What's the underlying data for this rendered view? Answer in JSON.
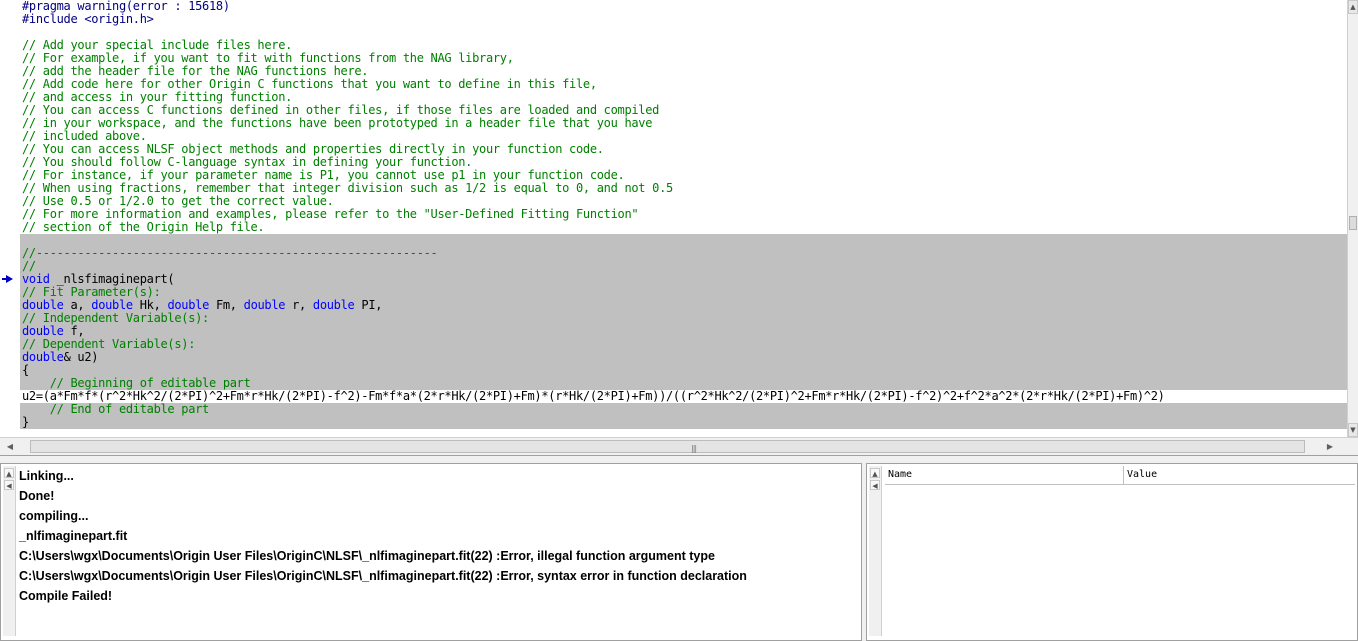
{
  "editor": {
    "lines": [
      {
        "hl": false,
        "parts": [
          {
            "c": "pre",
            "t": "#pragma warning(error : 15618)"
          }
        ]
      },
      {
        "hl": false,
        "parts": [
          {
            "c": "pre",
            "t": "#include <origin.h>"
          }
        ]
      },
      {
        "hl": false,
        "parts": [
          {
            "c": "plain",
            "t": ""
          }
        ]
      },
      {
        "hl": false,
        "parts": [
          {
            "c": "cmt",
            "t": "// Add your special include files here."
          }
        ]
      },
      {
        "hl": false,
        "parts": [
          {
            "c": "cmt",
            "t": "// For example, if you want to fit with functions from the NAG library,"
          }
        ]
      },
      {
        "hl": false,
        "parts": [
          {
            "c": "cmt",
            "t": "// add the header file for the NAG functions here."
          }
        ]
      },
      {
        "hl": false,
        "parts": [
          {
            "c": "cmt",
            "t": "// Add code here for other Origin C functions that you want to define in this file,"
          }
        ]
      },
      {
        "hl": false,
        "parts": [
          {
            "c": "cmt",
            "t": "// and access in your fitting function."
          }
        ]
      },
      {
        "hl": false,
        "parts": [
          {
            "c": "cmt",
            "t": "// You can access C functions defined in other files, if those files are loaded and compiled"
          }
        ]
      },
      {
        "hl": false,
        "parts": [
          {
            "c": "cmt",
            "t": "// in your workspace, and the functions have been prototyped in a header file that you have"
          }
        ]
      },
      {
        "hl": false,
        "parts": [
          {
            "c": "cmt",
            "t": "// included above."
          }
        ]
      },
      {
        "hl": false,
        "parts": [
          {
            "c": "cmt",
            "t": "// You can access NLSF object methods and properties directly in your function code."
          }
        ]
      },
      {
        "hl": false,
        "parts": [
          {
            "c": "cmt",
            "t": "// You should follow C-language syntax in defining your function."
          }
        ]
      },
      {
        "hl": false,
        "parts": [
          {
            "c": "cmt",
            "t": "// For instance, if your parameter name is P1, you cannot use p1 in your function code."
          }
        ]
      },
      {
        "hl": false,
        "parts": [
          {
            "c": "cmt",
            "t": "// When using fractions, remember that integer division such as 1/2 is equal to 0, and not 0.5"
          }
        ]
      },
      {
        "hl": false,
        "parts": [
          {
            "c": "cmt",
            "t": "// Use 0.5 or 1/2.0 to get the correct value."
          }
        ]
      },
      {
        "hl": false,
        "parts": [
          {
            "c": "cmt",
            "t": "// For more information and examples, please refer to the \"User-Defined Fitting Function\""
          }
        ]
      },
      {
        "hl": false,
        "parts": [
          {
            "c": "cmt",
            "t": "// section of the Origin Help file."
          }
        ]
      },
      {
        "hl": true,
        "parts": [
          {
            "c": "plain",
            "t": ""
          }
        ]
      },
      {
        "hl": true,
        "parts": [
          {
            "c": "cmt",
            "t": "//----------------------------------------------------------"
          }
        ]
      },
      {
        "hl": true,
        "parts": [
          {
            "c": "cmt",
            "t": "//"
          }
        ]
      },
      {
        "hl": true,
        "parts": [
          {
            "c": "kw",
            "t": "void"
          },
          {
            "c": "plain",
            "t": " _nlsfimaginepart("
          }
        ]
      },
      {
        "hl": true,
        "parts": [
          {
            "c": "cmt",
            "t": "// Fit Parameter(s):"
          }
        ]
      },
      {
        "hl": true,
        "parts": [
          {
            "c": "kw",
            "t": "double"
          },
          {
            "c": "plain",
            "t": " a, "
          },
          {
            "c": "kw",
            "t": "double"
          },
          {
            "c": "plain",
            "t": " Hk, "
          },
          {
            "c": "kw",
            "t": "double"
          },
          {
            "c": "plain",
            "t": " Fm, "
          },
          {
            "c": "kw",
            "t": "double"
          },
          {
            "c": "plain",
            "t": " r, "
          },
          {
            "c": "kw",
            "t": "double"
          },
          {
            "c": "plain",
            "t": " PI,"
          }
        ]
      },
      {
        "hl": true,
        "parts": [
          {
            "c": "cmt",
            "t": "// Independent Variable(s):"
          }
        ]
      },
      {
        "hl": true,
        "parts": [
          {
            "c": "kw",
            "t": "double"
          },
          {
            "c": "plain",
            "t": " f,"
          }
        ]
      },
      {
        "hl": true,
        "parts": [
          {
            "c": "cmt",
            "t": "// Dependent Variable(s):"
          }
        ]
      },
      {
        "hl": true,
        "parts": [
          {
            "c": "kw",
            "t": "double"
          },
          {
            "c": "plain",
            "t": "& u2)"
          }
        ]
      },
      {
        "hl": true,
        "parts": [
          {
            "c": "plain",
            "t": "{"
          }
        ]
      },
      {
        "hl": true,
        "parts": [
          {
            "c": "cmt",
            "t": "    // Beginning of editable part"
          }
        ]
      },
      {
        "hl": false,
        "parts": [
          {
            "c": "plain",
            "t": "u2=(a*Fm*f*(r^2*Hk^2/(2*PI)^2+Fm*r*Hk/(2*PI)-f^2)-Fm*f*a*(2*r*Hk/(2*PI)+Fm)*(r*Hk/(2*PI)+Fm))/((r^2*Hk^2/(2*PI)^2+Fm*r*Hk/(2*PI)-f^2)^2+f^2*a^2*(2*r*Hk/(2*PI)+Fm)^2)"
          }
        ]
      },
      {
        "hl": true,
        "parts": [
          {
            "c": "cmt",
            "t": "    // End of editable part"
          }
        ]
      },
      {
        "hl": true,
        "parts": [
          {
            "c": "plain",
            "t": "}"
          }
        ]
      }
    ],
    "current_line_index": 21
  },
  "output": {
    "lines": [
      "Linking...",
      "Done!",
      "compiling...",
      "_nlfimaginepart.fit",
      "C:\\Users\\wgx\\Documents\\Origin User Files\\OriginC\\NLSF\\_nlfimaginepart.fit(22) :Error, illegal function argument type",
      "C:\\Users\\wgx\\Documents\\Origin User Files\\OriginC\\NLSF\\_nlfimaginepart.fit(22) :Error, syntax error in function declaration",
      "Compile Failed!"
    ]
  },
  "variables": {
    "col_name": "Name",
    "col_value": "Value"
  },
  "icons": {
    "current_line": "arrow-right-icon",
    "scroll_up": "triangle-up-icon",
    "scroll_down": "triangle-down-icon",
    "scroll_left": "triangle-left-icon",
    "scroll_right": "triangle-right-icon",
    "grip": "grip-icon"
  },
  "colors": {
    "comment": "#008000",
    "keyword": "#0000ff",
    "preprocessor": "#000080",
    "highlight": "#c0c0c0"
  }
}
